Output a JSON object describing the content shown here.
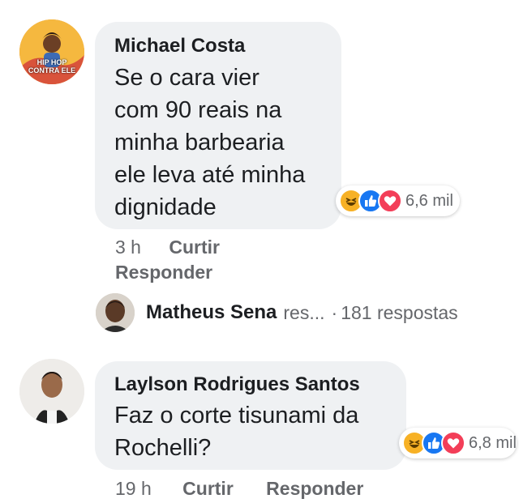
{
  "comments": [
    {
      "author": "Michael Costa",
      "text_lines": [
        "Se o cara vier",
        "com 90 reais na",
        "minha barbearia",
        "ele leva até minha",
        "dignidade"
      ],
      "avatar_caption": [
        "HIP HOP",
        "CONTRA ELE"
      ],
      "reactions": {
        "icons": [
          "haha-icon",
          "like-icon",
          "love-icon"
        ],
        "count": "6,6 mil"
      },
      "time": "3 h",
      "like_label": "Curtir",
      "reply_label": "Responder"
    },
    {
      "author": "Laylson Rodrigues Santos",
      "text_lines": [
        "Faz o corte tisunami da",
        "Rochelli?"
      ],
      "reactions": {
        "icons": [
          "haha-icon",
          "like-icon",
          "love-icon"
        ],
        "count": "6,8 mil"
      },
      "time": "19 h",
      "like_label": "Curtir",
      "reply_label": "Responder"
    }
  ],
  "reply_preview": {
    "name": "Matheus Sena",
    "truncated_action": "res...",
    "separator": "·",
    "replies_count": "181 respostas"
  },
  "colors": {
    "bubble": "#eff1f3",
    "like": "#1877f2",
    "love": "#f33e58",
    "haha": "#f7b125",
    "meta": "#65676b"
  }
}
